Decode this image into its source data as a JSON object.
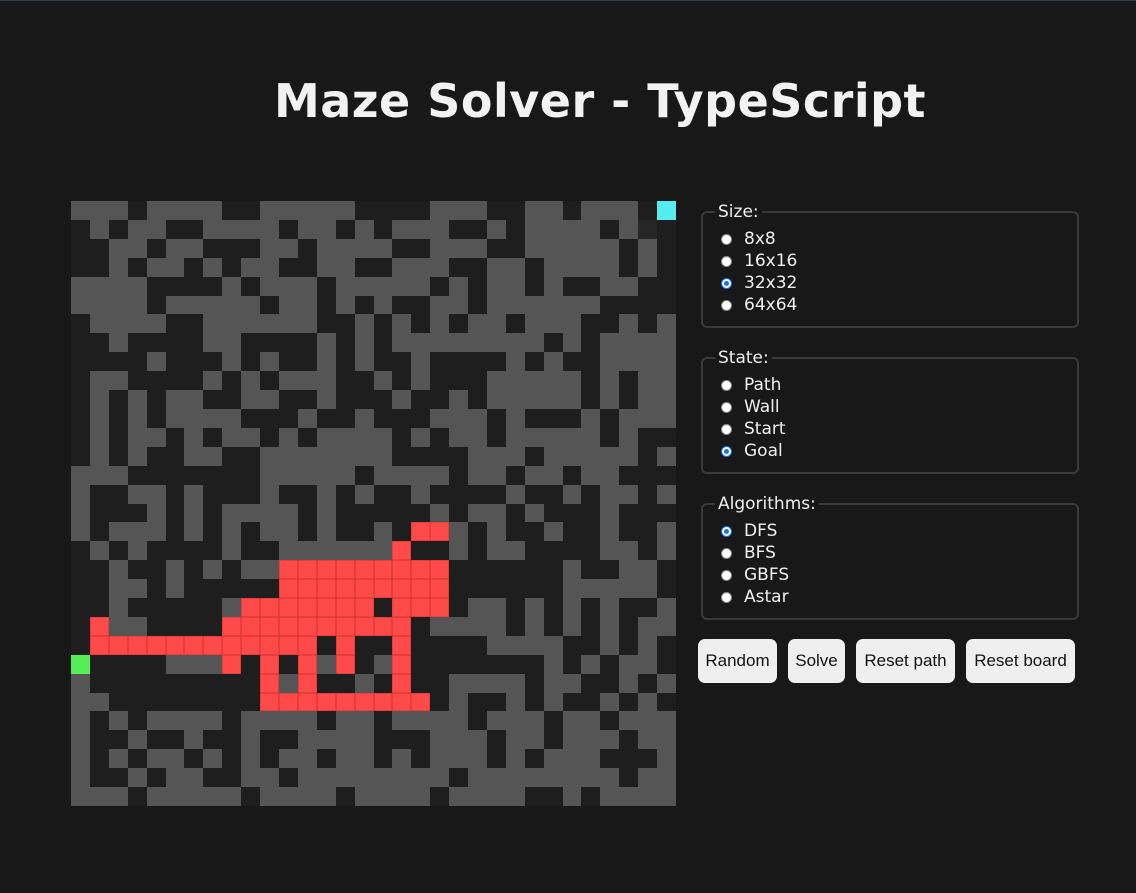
{
  "title": "Maze Solver - TypeScript",
  "maze": {
    "size": 32,
    "rows": [
      "ooowoooowwooooowwwwooowwoowooowg",
      "wowoowwoooowoowowooowwowoooowovw",
      "wwoowoowwwoowoooowwooowwooooowow",
      "wwowoowowoowwoowwooowwoowoooowow",
      "oooowwwwowooowooooowowoowowwooww",
      "oooowooooowoowowowwoowoooooowwww",
      "woooowwoooooowwowowowoowooowwowo",
      "wwowwwwoowwwwowowoooooooowowoooo",
      "wwwwowwwowowwowowwowwwwowowwoooo",
      "woowwwwowowooowwowowwwooooowowoo",
      "wowowoowwoowwowwwowwowooooowowoo",
      "wowowoooowwwowwowwwooowowwwowooo",
      "wowoowowoowowoooowowoowooooowoww",
      "wowowwoowwooooooowwwwooowooooowo",
      "ooowwwwwwwooooowoooowoowoowoowww",
      "owwoowowwwowwowowwowwwwowwowoowo",
      "owwwowowoooowowwwwwowoowowwwowww",
      "owooowowowoowowwowwwowowwowwowwo",
      "wowowwwwowwoooooowwwowoowwwwoowo",
      "wwowwowowooowowoowwwwwwwwwowwoow",
      "wwoowowwwwwwwwwwoooowwwwwwooooow",
      "wwowwwwwooooowwwwowwwoowowowowwo",
      "wwoowwwwwwowwwwwwwwoooowowowowoo",
      "wwwwooowwwwwwwwwwowwwwoooowwowow",
      "swwwwooowwwwwoowowwwwwwwwowowoow",
      "owwwwwwwwwwoowwowwwwoooowoowwowo",
      "oowwwwwwwwwoowwwwwwwowwowowwowow",
      "owowoooowoooowoowoooowooowoowooo",
      "owwowwowwowwoooowwwooowoowooowoo",
      "owowoowowowoowoowowooowowooowwwo",
      "owwowoowwoowoooooooowoooooooowoo",
      "ooowooooowoooowoooowoooowwowoooo"
    ],
    "path": [
      [
        17,
        18
      ],
      [
        17,
        19
      ],
      [
        18,
        17
      ],
      [
        19,
        17
      ],
      [
        20,
        17
      ],
      [
        21,
        17
      ],
      [
        19,
        18
      ],
      [
        19,
        19
      ],
      [
        20,
        14
      ],
      [
        21,
        14
      ],
      [
        22,
        14
      ],
      [
        23,
        14
      ],
      [
        24,
        14
      ],
      [
        20,
        15
      ],
      [
        21,
        15
      ],
      [
        22,
        10
      ],
      [
        23,
        10
      ],
      [
        24,
        10
      ],
      [
        25,
        10
      ],
      [
        26,
        10
      ],
      [
        22,
        11
      ],
      [
        22,
        12
      ],
      [
        23,
        2
      ],
      [
        23,
        3
      ],
      [
        23,
        4
      ],
      [
        23,
        5
      ],
      [
        23,
        6
      ],
      [
        23,
        7
      ],
      [
        23,
        8
      ],
      [
        23,
        9
      ],
      [
        21,
        9
      ],
      [
        21,
        10
      ],
      [
        21,
        11
      ],
      [
        22,
        9
      ],
      [
        22,
        13
      ],
      [
        22,
        16
      ],
      [
        22,
        17
      ],
      [
        19,
        11
      ],
      [
        20,
        11
      ],
      [
        21,
        12
      ],
      [
        20,
        12
      ],
      [
        21,
        13
      ],
      [
        20,
        13
      ],
      [
        20,
        16
      ],
      [
        20,
        18
      ],
      [
        20,
        19
      ],
      [
        21,
        19
      ],
      [
        21,
        18
      ],
      [
        22,
        1
      ],
      [
        23,
        1
      ],
      [
        22,
        8
      ],
      [
        24,
        8
      ],
      [
        23,
        11
      ],
      [
        23,
        12
      ],
      [
        24,
        12
      ],
      [
        25,
        12
      ],
      [
        26,
        12
      ],
      [
        26,
        11
      ],
      [
        26,
        13
      ],
      [
        26,
        14
      ],
      [
        26,
        15
      ],
      [
        26,
        16
      ],
      [
        26,
        17
      ],
      [
        26,
        18
      ],
      [
        25,
        17
      ],
      [
        24,
        17
      ],
      [
        23,
        17
      ],
      [
        22,
        15
      ],
      [
        19,
        12
      ],
      [
        19,
        13
      ],
      [
        19,
        14
      ],
      [
        19,
        15
      ],
      [
        19,
        16
      ],
      [
        20,
        17
      ]
    ]
  },
  "panel": {
    "size": {
      "legend": "Size:",
      "options": [
        {
          "label": "8x8",
          "selected": false
        },
        {
          "label": "16x16",
          "selected": false
        },
        {
          "label": "32x32",
          "selected": true
        },
        {
          "label": "64x64",
          "selected": false
        }
      ]
    },
    "state": {
      "legend": "State:",
      "options": [
        {
          "label": "Path",
          "selected": false
        },
        {
          "label": "Wall",
          "selected": false
        },
        {
          "label": "Start",
          "selected": false
        },
        {
          "label": "Goal",
          "selected": true
        }
      ]
    },
    "algorithms": {
      "legend": "Algorithms:",
      "options": [
        {
          "label": "DFS",
          "selected": true
        },
        {
          "label": "BFS",
          "selected": false
        },
        {
          "label": "GBFS",
          "selected": false
        },
        {
          "label": "Astar",
          "selected": false
        }
      ]
    }
  },
  "buttons": {
    "random": "Random",
    "solve": "Solve",
    "reset_path": "Reset path",
    "reset_board": "Reset board"
  },
  "colors": {
    "background": "#181818",
    "wall": "#1e1e1e",
    "open": "#555555",
    "path": "#ff4a4a",
    "start": "#55ee55",
    "goal": "#55eeee",
    "accent": "#1a73e8"
  }
}
